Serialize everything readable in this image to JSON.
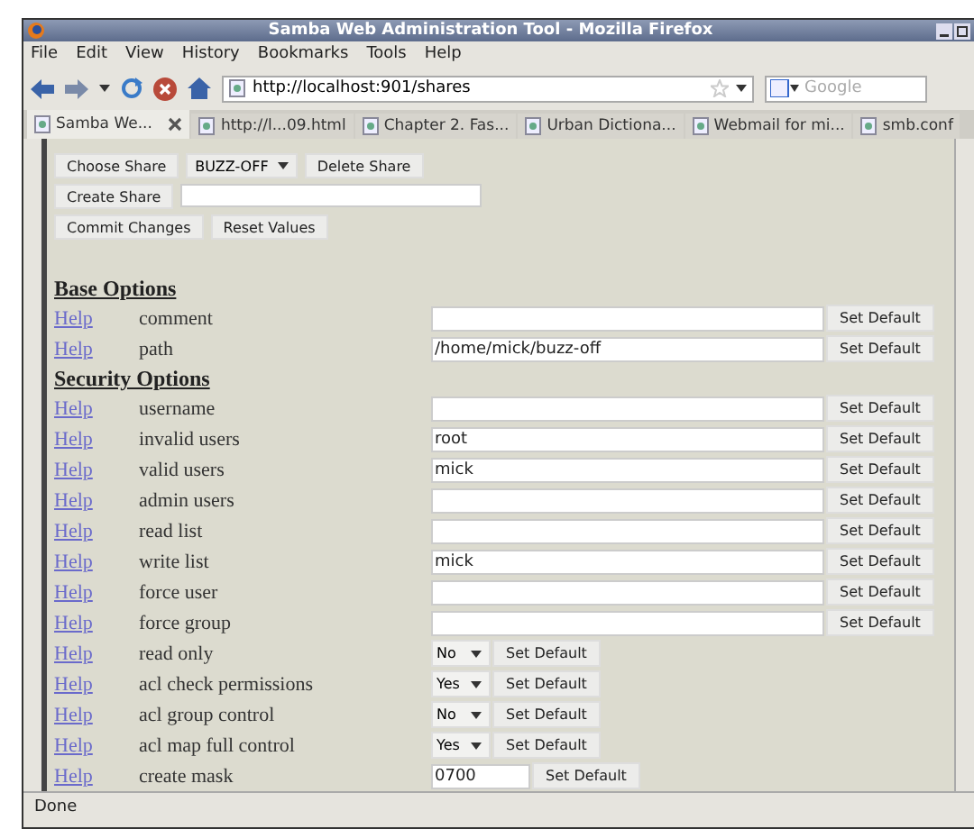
{
  "window": {
    "title": "Samba Web Administration Tool - Mozilla Firefox"
  },
  "menu": [
    "File",
    "Edit",
    "View",
    "History",
    "Bookmarks",
    "Tools",
    "Help"
  ],
  "toolbar": {
    "url": "http://localhost:901/shares",
    "search_placeholder": "Google"
  },
  "tabs": [
    {
      "label": "Samba We...",
      "selected": true,
      "closable": true
    },
    {
      "label": "http://l...09.html",
      "selected": false,
      "closable": false
    },
    {
      "label": "Chapter 2. Fas...",
      "selected": false,
      "closable": false
    },
    {
      "label": "Urban Dictiona...",
      "selected": false,
      "closable": false
    },
    {
      "label": "Webmail for mi...",
      "selected": false,
      "closable": false
    },
    {
      "label": "smb.conf",
      "selected": false,
      "closable": false
    }
  ],
  "share_controls": {
    "choose_button": "Choose Share",
    "share_select": "BUZZ-OFF",
    "delete_button": "Delete Share",
    "create_button": "Create Share",
    "commit_button": "Commit Changes",
    "reset_button": "Reset Values"
  },
  "sections": [
    {
      "title": "Base Options",
      "rows": [
        {
          "help": "Help",
          "name": "comment",
          "kind": "text",
          "value": "",
          "button": "Set Default"
        },
        {
          "help": "Help",
          "name": "path",
          "kind": "text",
          "value": "/home/mick/buzz-off",
          "button": "Set Default"
        }
      ]
    },
    {
      "title": "Security Options",
      "rows": [
        {
          "help": "Help",
          "name": "username",
          "kind": "text",
          "value": "",
          "button": "Set Default"
        },
        {
          "help": "Help",
          "name": "invalid users",
          "kind": "text",
          "value": "root",
          "button": "Set Default"
        },
        {
          "help": "Help",
          "name": "valid users",
          "kind": "text",
          "value": "mick",
          "button": "Set Default"
        },
        {
          "help": "Help",
          "name": "admin users",
          "kind": "text",
          "value": "",
          "button": "Set Default"
        },
        {
          "help": "Help",
          "name": "read list",
          "kind": "text",
          "value": "",
          "button": "Set Default"
        },
        {
          "help": "Help",
          "name": "write list",
          "kind": "text",
          "value": "mick",
          "button": "Set Default"
        },
        {
          "help": "Help",
          "name": "force user",
          "kind": "text",
          "value": "",
          "button": "Set Default"
        },
        {
          "help": "Help",
          "name": "force group",
          "kind": "text",
          "value": "",
          "button": "Set Default"
        },
        {
          "help": "Help",
          "name": "read only",
          "kind": "select",
          "value": "No",
          "button": "Set Default"
        },
        {
          "help": "Help",
          "name": "acl check permissions",
          "kind": "select",
          "value": "Yes",
          "button": "Set Default"
        },
        {
          "help": "Help",
          "name": "acl group control",
          "kind": "select",
          "value": "No",
          "button": "Set Default"
        },
        {
          "help": "Help",
          "name": "acl map full control",
          "kind": "select",
          "value": "Yes",
          "button": "Set Default"
        },
        {
          "help": "Help",
          "name": "create mask",
          "kind": "short",
          "value": "0700",
          "button": "Set Default"
        }
      ]
    }
  ],
  "status_bar": "Done"
}
